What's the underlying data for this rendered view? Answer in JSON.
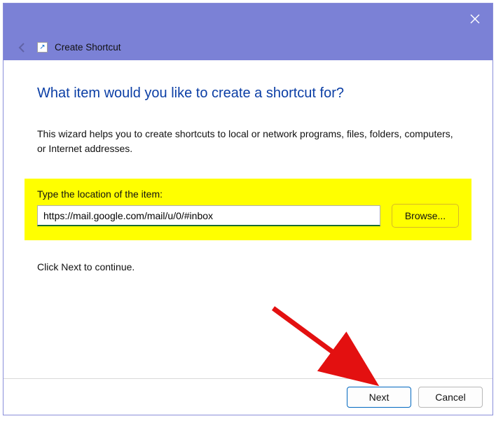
{
  "titlebar": {
    "title": "Create Shortcut"
  },
  "wizard": {
    "heading": "What item would you like to create a shortcut for?",
    "intro": "This wizard helps you to create shortcuts to local or network programs, files, folders, computers, or Internet addresses.",
    "location_label": "Type the location of the item:",
    "location_value": "https://mail.google.com/mail/u/0/#inbox",
    "browse_label": "Browse...",
    "continue_hint": "Click Next to continue."
  },
  "footer": {
    "next_label": "Next",
    "cancel_label": "Cancel"
  }
}
